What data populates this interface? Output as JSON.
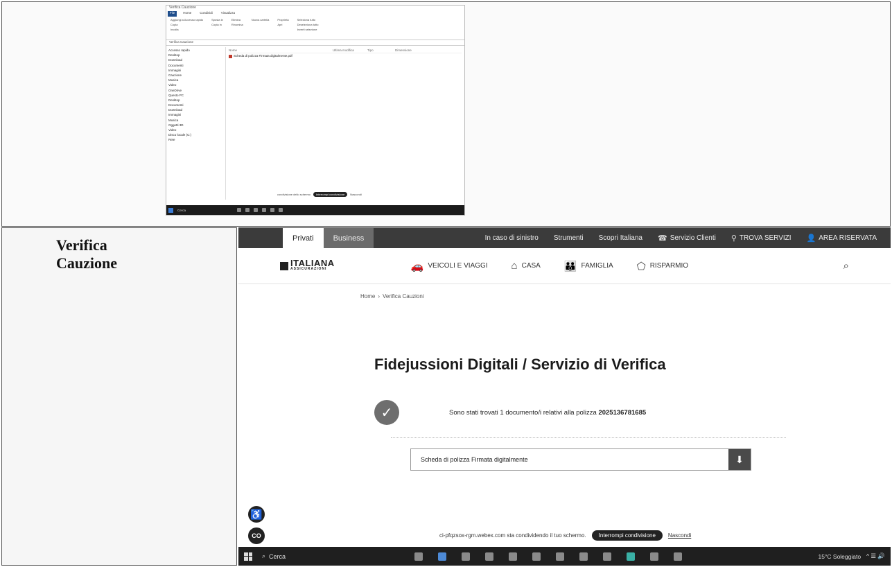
{
  "top_screenshot": {
    "explorer": {
      "title": "Verifica Cauzione",
      "tabs": [
        "File",
        "Home",
        "Condividi",
        "Visualizza"
      ],
      "ribbon": [
        [
          "Aggiungi a Accesso rapido",
          "Copia",
          "Incolla"
        ],
        [
          "Sposta in",
          "Copia in"
        ],
        [
          "Elimina",
          "Rinomina"
        ],
        [
          "Nuova cartella"
        ],
        [
          "Proprietà",
          "Apri"
        ],
        [
          "Seleziona tutto",
          "Deseleziona tutto",
          "Inverti selezione"
        ]
      ],
      "address": "Verifica Cauzione",
      "nav_items": [
        "Accesso rapido",
        "Desktop",
        "Download",
        "Documenti",
        "Immagini",
        "Cauzione",
        "Musica",
        "Video",
        "OneDrive",
        "Questo PC",
        "Desktop",
        "Documenti",
        "Download",
        "Immagini",
        "Musica",
        "Oggetti 3D",
        "Video",
        "Disco locale (C:)",
        "Rete"
      ],
      "columns": [
        "Nome",
        "Ultima modifica",
        "Tipo",
        "Dimensione"
      ],
      "files": [
        {
          "name": "Scheda di polizza Firmata digitalmente.pdf",
          "date": "",
          "type": "",
          "size": ""
        }
      ],
      "share_text": "condivisione dello schermo",
      "share_stop": "Interrompi condivisione",
      "share_hide": "Nascondi",
      "taskbar_search": "Cerca"
    }
  },
  "label": {
    "line1": "Verifica",
    "line2": "Cauzione"
  },
  "site": {
    "topbar": {
      "tab_active": "Privati",
      "tab_other": "Business",
      "links": [
        {
          "label": "In caso di sinistro",
          "icon": ""
        },
        {
          "label": "Strumenti",
          "icon": ""
        },
        {
          "label": "Scopri Italiana",
          "icon": ""
        },
        {
          "label": "Servizio Clienti",
          "icon": "☎"
        },
        {
          "label": "TROVA SERVIZI",
          "icon": "⚲"
        },
        {
          "label": "AREA RISERVATA",
          "icon": "👤"
        }
      ]
    },
    "logo": {
      "name": "ITALIANA",
      "sub": "ASSICURAZIONI"
    },
    "nav": [
      {
        "label": "VEICOLI E VIAGGI",
        "icon": "🚗"
      },
      {
        "label": "CASA",
        "icon": "⌂"
      },
      {
        "label": "FAMIGLIA",
        "icon": "👪"
      },
      {
        "label": "RISPARMIO",
        "icon": "⬠"
      }
    ],
    "search_icon": "⌕",
    "breadcrumb": {
      "home": "Home",
      "sep": "›",
      "current": "Verifica Cauzioni"
    },
    "title": {
      "strong": "Fidejussioni Digitali",
      "rest": " / Servizio di Verifica"
    },
    "result": {
      "check": "✓",
      "text_prefix": "Sono stati trovati 1 documento/i relativi alla polizza ",
      "policy_number": "2025136781685"
    },
    "document": {
      "label": "Scheda di polizza Firmata digitalmente",
      "download_icon": "⬇"
    },
    "fab_accessibility": "♿",
    "fab_co": "CO",
    "share_bar": {
      "text": "ci-pfqzsox-rgm.webex.com sta condividendo il tuo schermo.",
      "stop": "Interrompi condivisione",
      "hide": "Nascondi"
    },
    "taskbar": {
      "search_icon": "⌕",
      "search": "Cerca",
      "weather": "15°C Soleggiato",
      "tray": "^ ☰ 🔊"
    }
  }
}
